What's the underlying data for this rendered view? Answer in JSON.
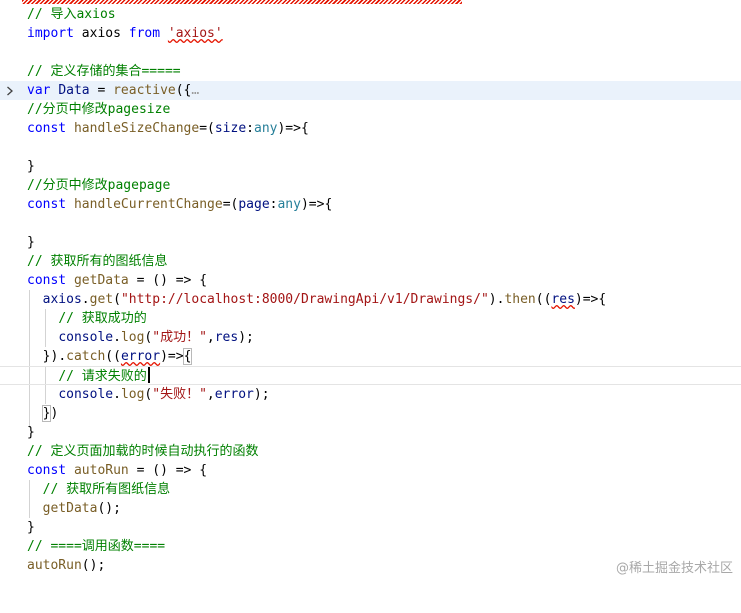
{
  "lines": [
    "// 导入axios",
    "import axios from 'axios'",
    "",
    "// 定义存储的集合=====",
    "var Data = reactive({…",
    "//分页中修改pagesize",
    "const handleSizeChange=(size:any)=>{",
    "",
    "}",
    "//分页中修改pagepage",
    "const handleCurrentChange=(page:any)=>{",
    "",
    "}",
    "// 获取所有的图纸信息",
    "const getData = () => {",
    "  axios.get(\"http://localhost:8000/DrawingApi/v1/Drawings/\").then((res)=>{",
    "    // 获取成功的",
    "    console.log(\"成功！\",res);",
    "  }).catch((error)=>{",
    "    // 请求失败的",
    "    console.log(\"失败！\",error);",
    "  })",
    "}",
    "// 定义页面加载的时候自动执行的函数",
    "const autoRun = () => {",
    "  // 获取所有图纸信息",
    "  getData();",
    "}",
    "// ====调用函数====",
    "autoRun();"
  ],
  "tokens": {
    "l0": [
      "// 导入axios"
    ],
    "l1": [
      "import",
      " axios ",
      "from",
      " ",
      "'axios'"
    ],
    "l3": [
      "// 定义存储的集合====="
    ],
    "l4": [
      "var",
      " ",
      "Data",
      " = ",
      "reactive",
      "({",
      "…"
    ],
    "l5": [
      "//分页中修改pagesize"
    ],
    "l6": [
      "const",
      " ",
      "handleSizeChange",
      "=(",
      "size",
      ":",
      "any",
      ")=>{"
    ],
    "l8": [
      "}"
    ],
    "l9": [
      "//分页中修改pagepage"
    ],
    "l10": [
      "const",
      " ",
      "handleCurrentChange",
      "=(",
      "page",
      ":",
      "any",
      ")=>{"
    ],
    "l12": [
      "}"
    ],
    "l13": [
      "// 获取所有的图纸信息"
    ],
    "l14": [
      "const",
      " ",
      "getData",
      " = () => {"
    ],
    "l15": [
      "  ",
      "axios",
      ".",
      "get",
      "(",
      "\"http://localhost:8000/DrawingApi/v1/Drawings/\"",
      ").",
      "then",
      "((",
      "res",
      ")=>{"
    ],
    "l16": [
      "    ",
      "// 获取成功的"
    ],
    "l17": [
      "    ",
      "console",
      ".",
      "log",
      "(",
      "\"成功！\"",
      ",",
      "res",
      ");"
    ],
    "l18": [
      "  ",
      "})",
      ".",
      "catch",
      "((",
      "error",
      ")=>",
      "{"
    ],
    "l19": [
      "    ",
      "// 请求失败的"
    ],
    "l20": [
      "    ",
      "console",
      ".",
      "log",
      "(",
      "\"失败！\"",
      ",",
      "error",
      ");"
    ],
    "l21": [
      "  ",
      "}",
      ")"
    ],
    "l22": [
      "}"
    ],
    "l23": [
      "// 定义页面加载的时候自动执行的函数"
    ],
    "l24": [
      "const",
      " ",
      "autoRun",
      " = () => {"
    ],
    "l25": [
      "  ",
      "// 获取所有图纸信息"
    ],
    "l26": [
      "  ",
      "getData",
      "();"
    ],
    "l27": [
      "}"
    ],
    "l28": [
      "// ====调用函数===="
    ],
    "l29": [
      "autoRun",
      "();"
    ]
  },
  "watermark": "@稀土掘金技术社区",
  "colors": {
    "comment": "#008000",
    "keyword": "#0000ff",
    "string": "#a31515",
    "function": "#795e26",
    "variable": "#001080",
    "type": "#267f99",
    "error_squiggle": "#e51400",
    "current_line": "#eaf2fb"
  },
  "icons": {
    "fold": "chevron-right-icon"
  }
}
